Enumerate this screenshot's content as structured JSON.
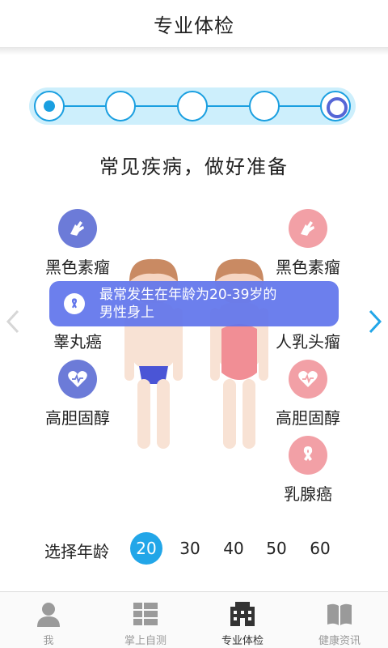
{
  "header": {
    "title": "专业体检"
  },
  "stepper": {
    "steps": 5,
    "current": 1
  },
  "headline": "常见疾病，做好准备",
  "diseases": {
    "male": [
      "黑色素瘤",
      "睾丸癌",
      "高胆固醇"
    ],
    "female": [
      "黑色素瘤",
      "人乳头瘤",
      "高胆固醇",
      "乳腺癌"
    ]
  },
  "tooltip": {
    "line1": "最常发生在年龄为20-39岁的",
    "line2": "男性身上"
  },
  "age_selector": {
    "label": "选择年龄",
    "options": [
      "20",
      "30",
      "40",
      "50",
      "60"
    ],
    "selected": "20"
  },
  "tabs": [
    {
      "label": "我",
      "icon": "person-icon"
    },
    {
      "label": "掌上自测",
      "icon": "list-icon"
    },
    {
      "label": "专业体检",
      "icon": "hospital-icon"
    },
    {
      "label": "健康资讯",
      "icon": "book-icon"
    }
  ],
  "colors": {
    "accent": "#22a6e8",
    "male": "#6c7bd8",
    "female": "#f2a0a6",
    "tooltip": "#6074eb"
  }
}
